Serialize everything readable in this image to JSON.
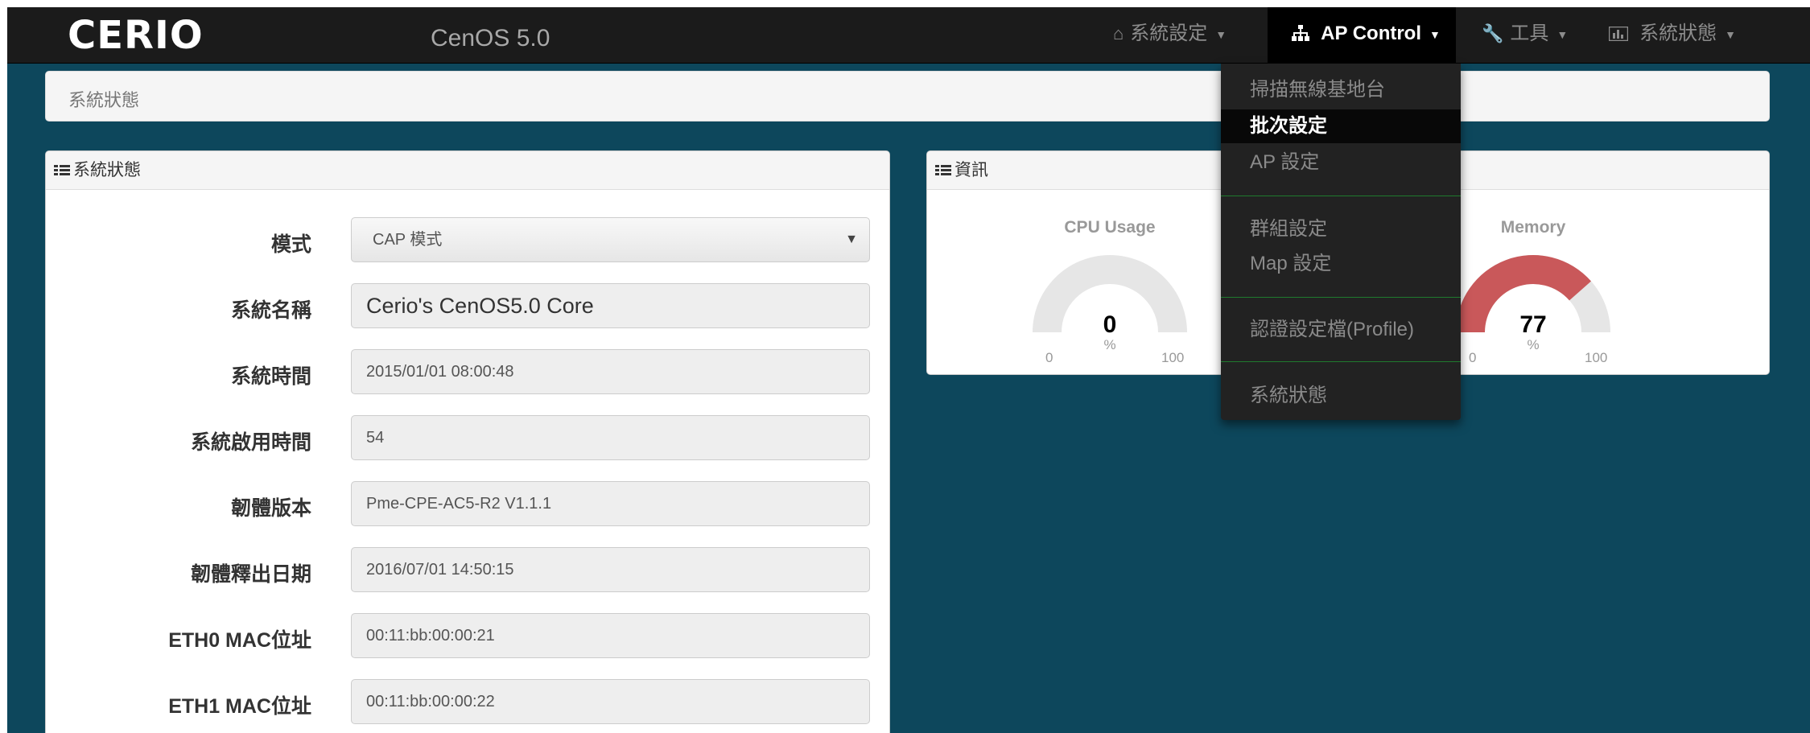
{
  "navbar": {
    "logo": "CERIO",
    "brand": "CenOS 5.0",
    "items": [
      {
        "label": "系統設定",
        "icon": "home-icon"
      },
      {
        "label": "AP Control",
        "icon": "sitemap-icon"
      },
      {
        "label": "工具",
        "icon": "wrench-icon"
      },
      {
        "label": "系統狀態",
        "icon": "bar-chart-icon"
      }
    ]
  },
  "breadcrumb": "系統狀態",
  "status_panel": {
    "title": "系統狀態",
    "rows": [
      {
        "label": "模式",
        "value": "CAP 模式"
      },
      {
        "label": "系統名稱",
        "value": "Cerio's CenOS5.0 Core"
      },
      {
        "label": "系統時間",
        "value": "2015/01/01 08:00:48"
      },
      {
        "label": "系統啟用時間",
        "value": "54"
      },
      {
        "label": "韌體版本",
        "value": "Pme-CPE-AC5-R2 V1.1.1"
      },
      {
        "label": "韌體釋出日期",
        "value": "2016/07/01 14:50:15"
      },
      {
        "label": "ETH0 MAC位址",
        "value": "00:11:bb:00:00:21"
      },
      {
        "label": "ETH1 MAC位址",
        "value": "00:11:bb:00:00:22"
      }
    ]
  },
  "info_panel": {
    "title": "資訊",
    "gauges": [
      {
        "title": "CPU Usage",
        "value": "0",
        "unit": "%",
        "min": "0",
        "max": "100",
        "fraction": 0.0,
        "color": "#c9585a"
      },
      {
        "title": "Memory",
        "value": "77",
        "unit": "%",
        "min": "0",
        "max": "100",
        "fraction": 0.77,
        "color": "#c9585a"
      }
    ]
  },
  "dropdown": {
    "items": [
      "掃描無線基地台",
      "批次設定",
      "AP 設定",
      "群組設定",
      "Map 設定",
      "認證設定檔(Profile)",
      "系統狀態"
    ],
    "active": "批次設定"
  },
  "colors": {
    "background": "#0d475c",
    "navbar": "#1b1b1b",
    "divider": "#1f7a2e",
    "gauge_track": "#e6e6e6",
    "gauge_fill": "#c9585a"
  }
}
